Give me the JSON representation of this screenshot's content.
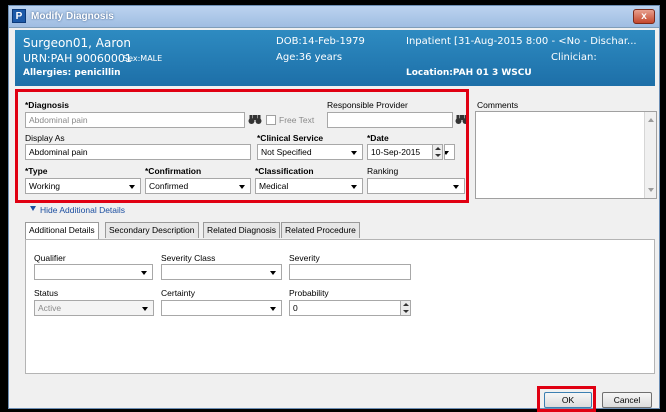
{
  "window": {
    "title": "Modify Diagnosis",
    "app_icon": "P",
    "close_label": "x"
  },
  "banner": {
    "patient_name": "Surgeon01, Aaron",
    "urn": "URN:PAH 90060001",
    "sex": "Sex:MALE",
    "allergies": "Allergies: penicillin",
    "dob": "DOB:14-Feb-1979",
    "age": "Age:36 years",
    "encounter": "Inpatient [31-Aug-2015 8:00 - <No - Dischar...",
    "clinician": "Clinician:",
    "location": "Location:PAH 01 3 WSCU"
  },
  "form": {
    "diagnosis_label": "*Diagnosis",
    "diagnosis_value": "Abdominal pain",
    "free_text_label": "Free Text",
    "responsible_provider_label": "Responsible Provider",
    "responsible_provider_value": "",
    "display_as_label": "Display As",
    "display_as_value": "Abdominal pain",
    "clinical_service_label": "*Clinical Service",
    "clinical_service_value": "Not Specified",
    "date_label": "*Date",
    "date_value": "10-Sep-2015",
    "type_label": "*Type",
    "type_value": "Working",
    "confirmation_label": "*Confirmation",
    "confirmation_value": "Confirmed",
    "classification_label": "*Classification",
    "classification_value": "Medical",
    "ranking_label": "Ranking",
    "ranking_value": "",
    "comments_label": "Comments"
  },
  "toggle_details_label": "Hide Additional Details",
  "tabs": [
    {
      "label": "Additional Details",
      "active": true
    },
    {
      "label": "Secondary Description",
      "active": false
    },
    {
      "label": "Related Diagnosis",
      "active": false
    },
    {
      "label": "Related Procedure",
      "active": false
    }
  ],
  "details": {
    "qualifier_label": "Qualifier",
    "severity_class_label": "Severity Class",
    "severity_label": "Severity",
    "status_label": "Status",
    "status_value": "Active",
    "certainty_label": "Certainty",
    "probability_label": "Probability",
    "probability_value": "0"
  },
  "buttons": {
    "ok": "OK",
    "cancel": "Cancel"
  },
  "colors": {
    "highlight": "#e00012",
    "banner": "#1d6fa8"
  },
  "icons": [
    "binoculars-icon",
    "dropdown-arrow-icon",
    "spinner-icon",
    "chevron-down-icon"
  ]
}
